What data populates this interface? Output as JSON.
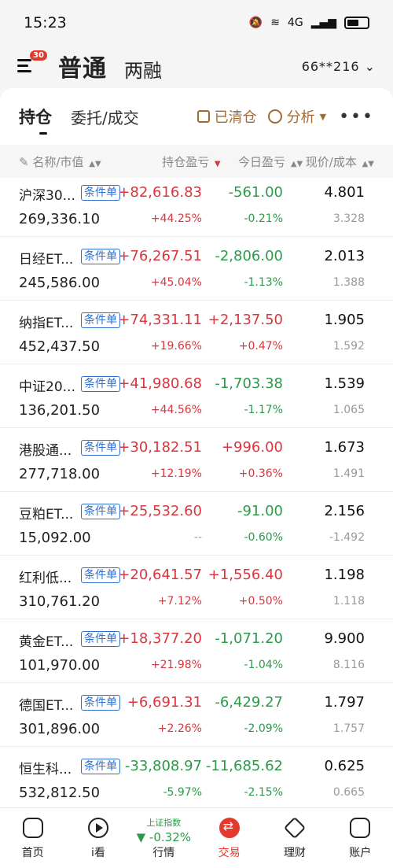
{
  "status": {
    "time": "15:23",
    "network": "4G"
  },
  "header": {
    "badge": "30",
    "tab_normal": "普通",
    "tab_margin": "两融",
    "account": "66**216"
  },
  "subtabs": {
    "holdings": "持仓",
    "orders": "委托/成交",
    "cleared": "已清仓",
    "analysis": "分析"
  },
  "columns": {
    "name": "名称/市值",
    "pnl": "持仓盈亏",
    "today": "今日盈亏",
    "price": "现价/成本"
  },
  "tag_label": "条件单",
  "rows": [
    {
      "name": "沪深30...",
      "mv": "269,336.10",
      "pl": "+82,616.83",
      "plp": "+44.25%",
      "today": "-561.00",
      "todayp": "-0.21%",
      "price": "4.801",
      "cost": "3.328",
      "pl_dir": "up",
      "today_dir": "down"
    },
    {
      "name": "日经ET...",
      "mv": "245,586.00",
      "pl": "+76,267.51",
      "plp": "+45.04%",
      "today": "-2,806.00",
      "todayp": "-1.13%",
      "price": "2.013",
      "cost": "1.388",
      "pl_dir": "up",
      "today_dir": "down"
    },
    {
      "name": "纳指ET...",
      "mv": "452,437.50",
      "pl": "+74,331.11",
      "plp": "+19.66%",
      "today": "+2,137.50",
      "todayp": "+0.47%",
      "price": "1.905",
      "cost": "1.592",
      "pl_dir": "up",
      "today_dir": "up"
    },
    {
      "name": "中证20...",
      "mv": "136,201.50",
      "pl": "+41,980.68",
      "plp": "+44.56%",
      "today": "-1,703.38",
      "todayp": "-1.17%",
      "price": "1.539",
      "cost": "1.065",
      "pl_dir": "up",
      "today_dir": "down"
    },
    {
      "name": "港股通...",
      "mv": "277,718.00",
      "pl": "+30,182.51",
      "plp": "+12.19%",
      "today": "+996.00",
      "todayp": "+0.36%",
      "price": "1.673",
      "cost": "1.491",
      "pl_dir": "up",
      "today_dir": "up"
    },
    {
      "name": "豆粕ET...",
      "mv": "15,092.00",
      "pl": "+25,532.60",
      "plp": "--",
      "today": "-91.00",
      "todayp": "-0.60%",
      "price": "2.156",
      "cost": "-1.492",
      "pl_dir": "up",
      "today_dir": "down"
    },
    {
      "name": "红利低...",
      "mv": "310,761.20",
      "pl": "+20,641.57",
      "plp": "+7.12%",
      "today": "+1,556.40",
      "todayp": "+0.50%",
      "price": "1.198",
      "cost": "1.118",
      "pl_dir": "up",
      "today_dir": "up"
    },
    {
      "name": "黄金ET...",
      "mv": "101,970.00",
      "pl": "+18,377.20",
      "plp": "+21.98%",
      "today": "-1,071.20",
      "todayp": "-1.04%",
      "price": "9.900",
      "cost": "8.116",
      "pl_dir": "up",
      "today_dir": "down"
    },
    {
      "name": "德国ET...",
      "mv": "301,896.00",
      "pl": "+6,691.31",
      "plp": "+2.26%",
      "today": "-6,429.27",
      "todayp": "-2.09%",
      "price": "1.797",
      "cost": "1.757",
      "pl_dir": "up",
      "today_dir": "down"
    },
    {
      "name": "恒生科...",
      "mv": "532,812.50",
      "pl": "-33,808.97",
      "plp": "-5.97%",
      "today": "-11,685.62",
      "todayp": "-2.15%",
      "price": "0.625",
      "cost": "0.665",
      "pl_dir": "down",
      "today_dir": "down"
    }
  ],
  "nav": {
    "home": "首页",
    "watch": "i看",
    "market": "行情",
    "market_index_name": "上证指数",
    "market_index_value": "▼ -0.32%",
    "trade": "交易",
    "wealth": "理财",
    "account": "账户"
  },
  "colors": {
    "up": "#d9363e",
    "down": "#2c9a4a",
    "accent": "#e23b2e",
    "tool": "#a36a2d",
    "tag": "#2e6fd0"
  }
}
